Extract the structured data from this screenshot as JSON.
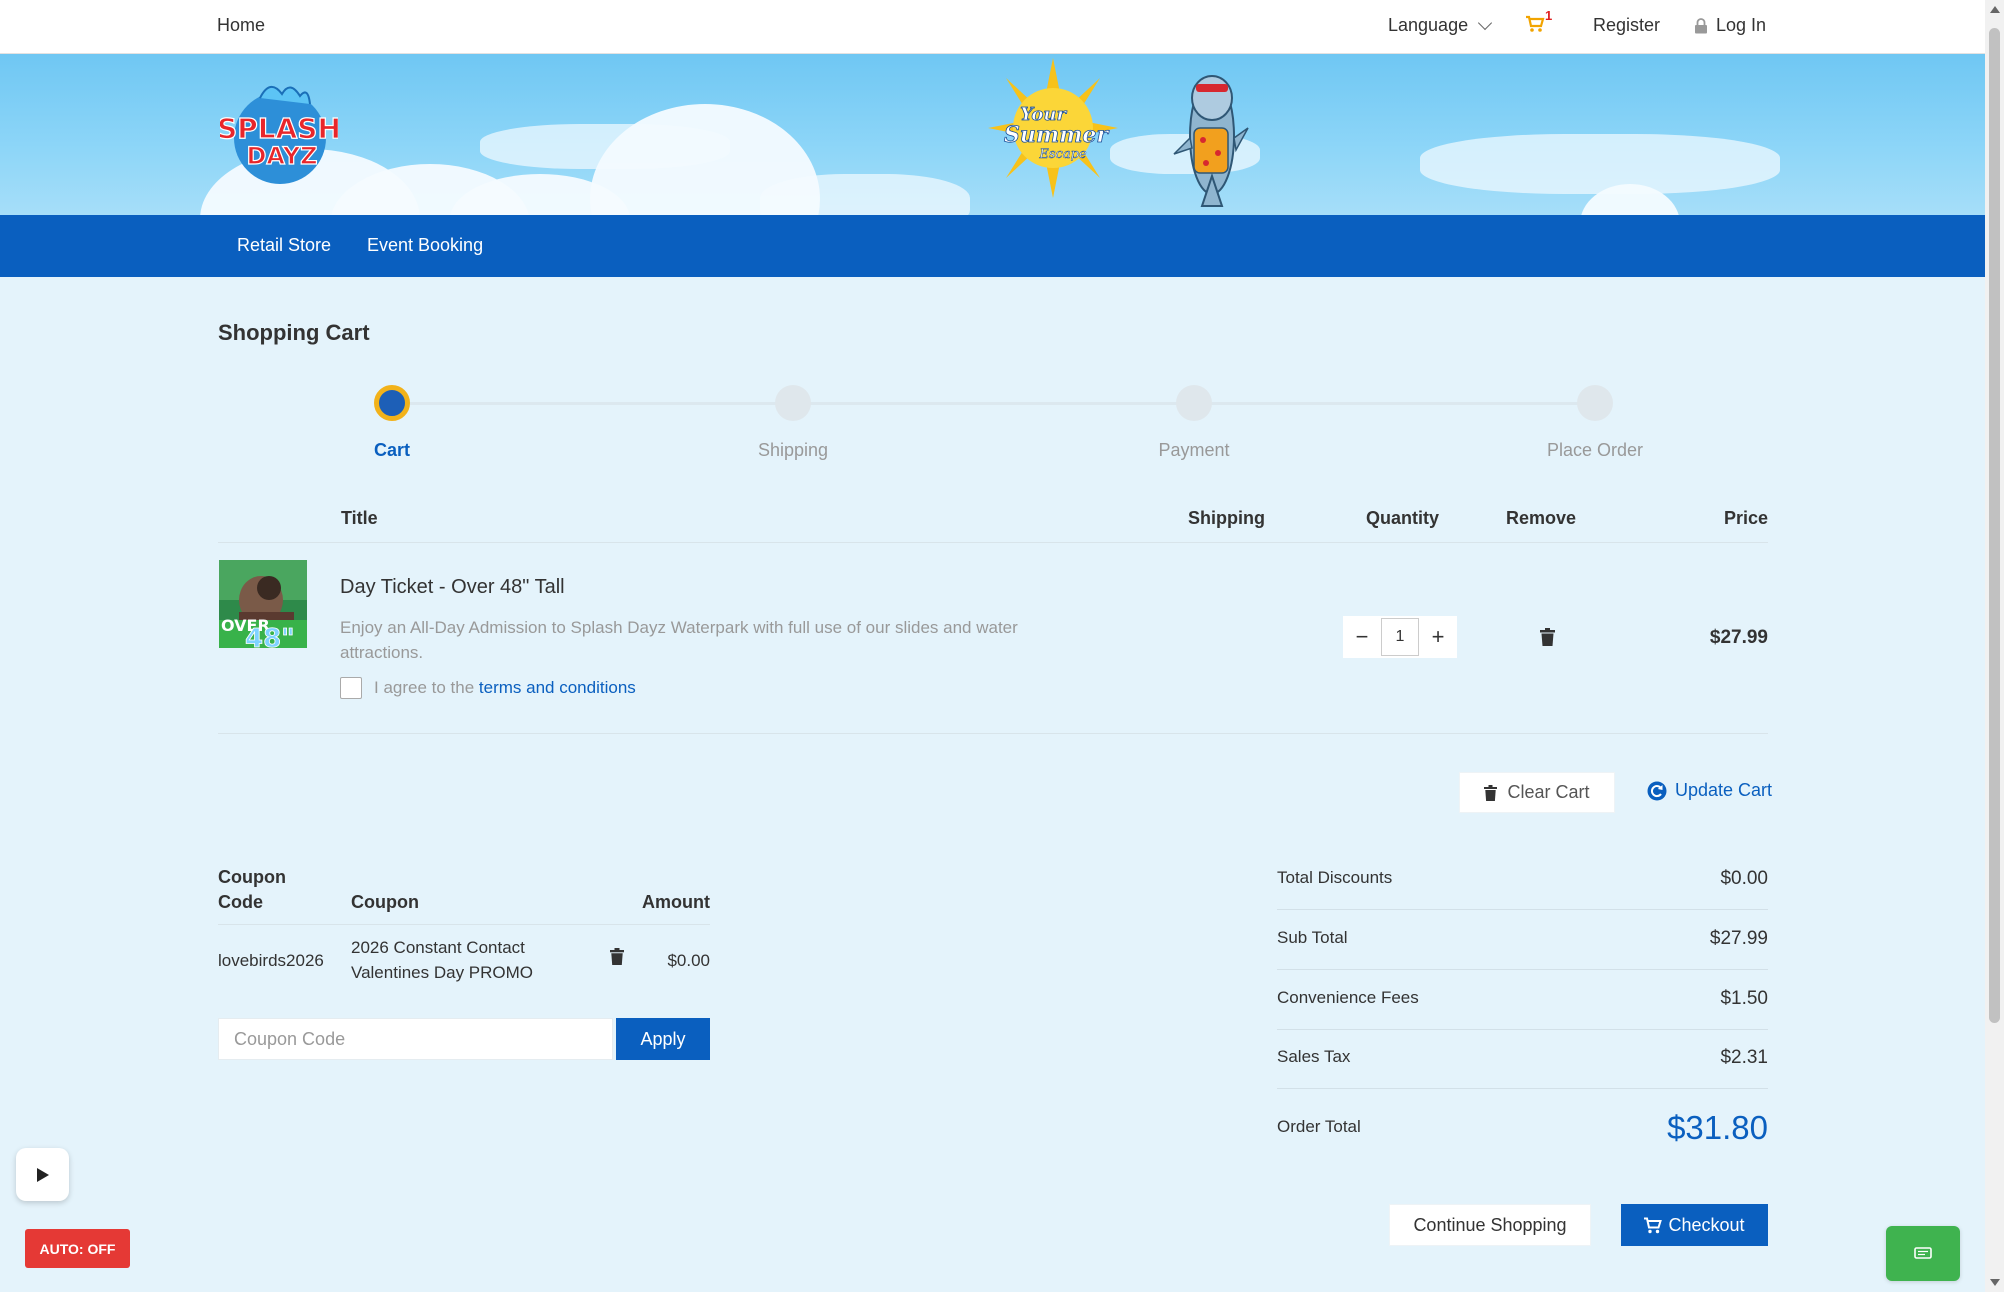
{
  "topnav": {
    "home": "Home",
    "language": "Language",
    "cart_count": "1",
    "register": "Register",
    "login": "Log In"
  },
  "banner": {
    "logo_text_1": "SPLASH",
    "logo_text_2": "DAYZ",
    "sun_text_1": "Your",
    "sun_text_2": "Summer",
    "sun_text_3": "Escape"
  },
  "mainnav": {
    "items": [
      "Retail Store",
      "Event Booking"
    ]
  },
  "page": {
    "title": "Shopping Cart"
  },
  "stepper": {
    "steps": [
      "Cart",
      "Shipping",
      "Payment",
      "Place Order"
    ],
    "active_index": 0
  },
  "cart_table": {
    "headers": {
      "title": "Title",
      "shipping": "Shipping",
      "quantity": "Quantity",
      "remove": "Remove",
      "price": "Price"
    },
    "items": [
      {
        "title": "Day Ticket - Over 48\" Tall",
        "description": "Enjoy an All-Day Admission to Splash Dayz Waterpark with full use of our slides and water attractions.",
        "thumb_text_1": "OVER",
        "thumb_text_2": "48\"",
        "quantity": "1",
        "price": "$27.99",
        "terms_prefix": "I agree to the",
        "terms_link": "terms and conditions"
      }
    ]
  },
  "cart_actions": {
    "clear_cart": "Clear Cart",
    "update_cart": "Update Cart"
  },
  "coupons": {
    "headers": {
      "code": "Coupon Code",
      "coupon": "Coupon",
      "amount": "Amount"
    },
    "rows": [
      {
        "code": "lovebirds2026",
        "name": "2026 Constant Contact Valentines Day PROMO",
        "amount": "$0.00"
      }
    ],
    "input_placeholder": "Coupon Code",
    "apply_label": "Apply"
  },
  "summary": {
    "rows": [
      {
        "label": "Total Discounts",
        "amount": "$0.00"
      },
      {
        "label": "Sub Total",
        "amount": "$27.99"
      },
      {
        "label": "Convenience Fees",
        "amount": "$1.50"
      },
      {
        "label": "Sales Tax",
        "amount": "$2.31"
      }
    ],
    "total_label": "Order Total",
    "total_amount": "$31.80"
  },
  "footer_actions": {
    "continue": "Continue Shopping",
    "checkout": "Checkout"
  },
  "widgets": {
    "auto_toggle": "AUTO: OFF"
  },
  "colors": {
    "brand_blue": "#0a5fbf",
    "step_active_ring": "#f2b21a",
    "page_bg": "#e4f3fb",
    "auto_red": "#e53935",
    "chat_green": "#3fb34f"
  }
}
